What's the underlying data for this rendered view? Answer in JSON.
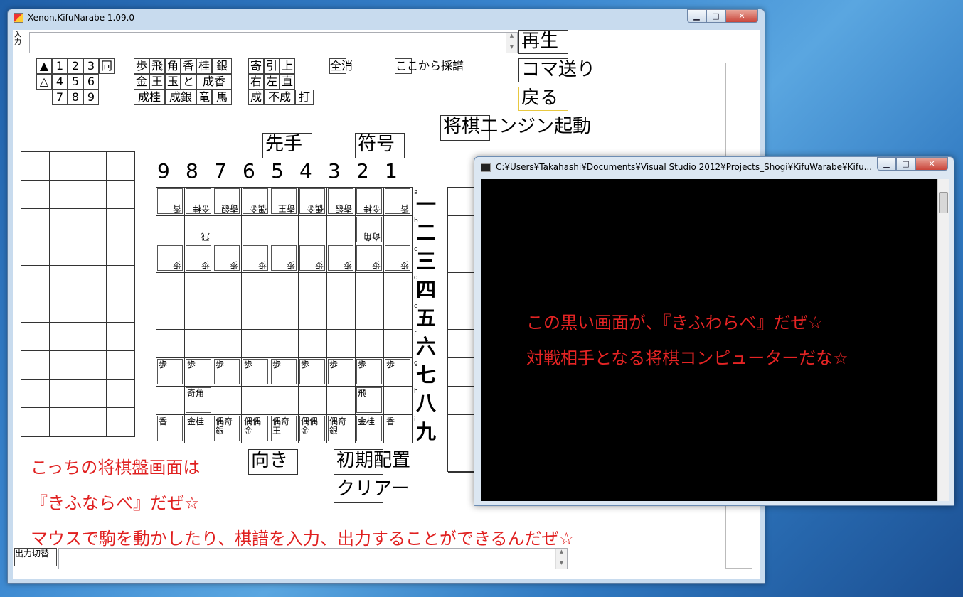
{
  "main_window": {
    "title": "Xenon.KifuNarabe 1.09.0",
    "input_label": "入\n力",
    "output_toggle_label": "出力切替"
  },
  "controls": {
    "play": "再生",
    "step": "コマ送り",
    "back": "戻る",
    "engine_start": "将棋エンジン起動",
    "sente": "先手",
    "notation": "符号",
    "orientation": "向き",
    "initial_setup": "初期配置",
    "clear": "クリアー",
    "clear_all": "全消",
    "record_from_here": "ここから採譜"
  },
  "pad": {
    "sente_mark": "▲",
    "gote_mark": "△",
    "digits": [
      "1",
      "2",
      "3",
      "4",
      "5",
      "6",
      "7",
      "8",
      "9"
    ],
    "same": "同"
  },
  "piece_buttons": {
    "row1": [
      "歩",
      "飛",
      "角",
      "香",
      "桂",
      "銀"
    ],
    "row2": [
      "金",
      "王",
      "玉",
      "と",
      "成香"
    ],
    "row3": [
      "成桂",
      "成銀",
      "竜",
      "馬"
    ]
  },
  "move_buttons": {
    "row1": [
      "寄",
      "引",
      "上"
    ],
    "row2": [
      "右",
      "左",
      "直"
    ],
    "row3": [
      "成",
      "不成",
      "打"
    ]
  },
  "board": {
    "col_labels": [
      "9",
      "8",
      "7",
      "6",
      "5",
      "4",
      "3",
      "2",
      "1"
    ],
    "row_labels": [
      "一",
      "二",
      "三",
      "四",
      "五",
      "六",
      "七",
      "八",
      "九"
    ],
    "row_letters": [
      "a",
      "b",
      "c",
      "d",
      "e",
      "f",
      "g",
      "h",
      "i"
    ],
    "gote_row1": [
      "香",
      "金桂",
      "奇銀",
      "偶金",
      "奇王",
      "偶金",
      "奇銀",
      "金桂",
      "香"
    ],
    "gote_rook": "飛",
    "gote_bishop": "奇角",
    "pawn": "歩",
    "sente_rook": "飛",
    "sente_bishop": "奇角",
    "sente_row9": [
      "香",
      "金桂",
      "偶奇銀",
      "偶偶金",
      "偶奇王",
      "偶偶金",
      "偶奇銀",
      "金桂",
      "香"
    ]
  },
  "notes": {
    "line1": "こっちの将棋盤画面は",
    "line2": "『きふならべ』だぜ☆",
    "line3": "マウスで駒を動かしたり、棋譜を入力、出力することができるんだぜ☆"
  },
  "console_window": {
    "title": "C:¥Users¥Takahashi¥Documents¥Visual Studio 2012¥Projects_Shogi¥KifuWarabe¥Kifu...",
    "line1": "この黒い画面が、『きふわらべ』だぜ☆",
    "line2": "対戦相手となる将棋コンピューターだな☆"
  },
  "colors": {
    "note_red": "#e02020",
    "console_bg": "#000000",
    "desktop_blue": "#3a86cf"
  }
}
